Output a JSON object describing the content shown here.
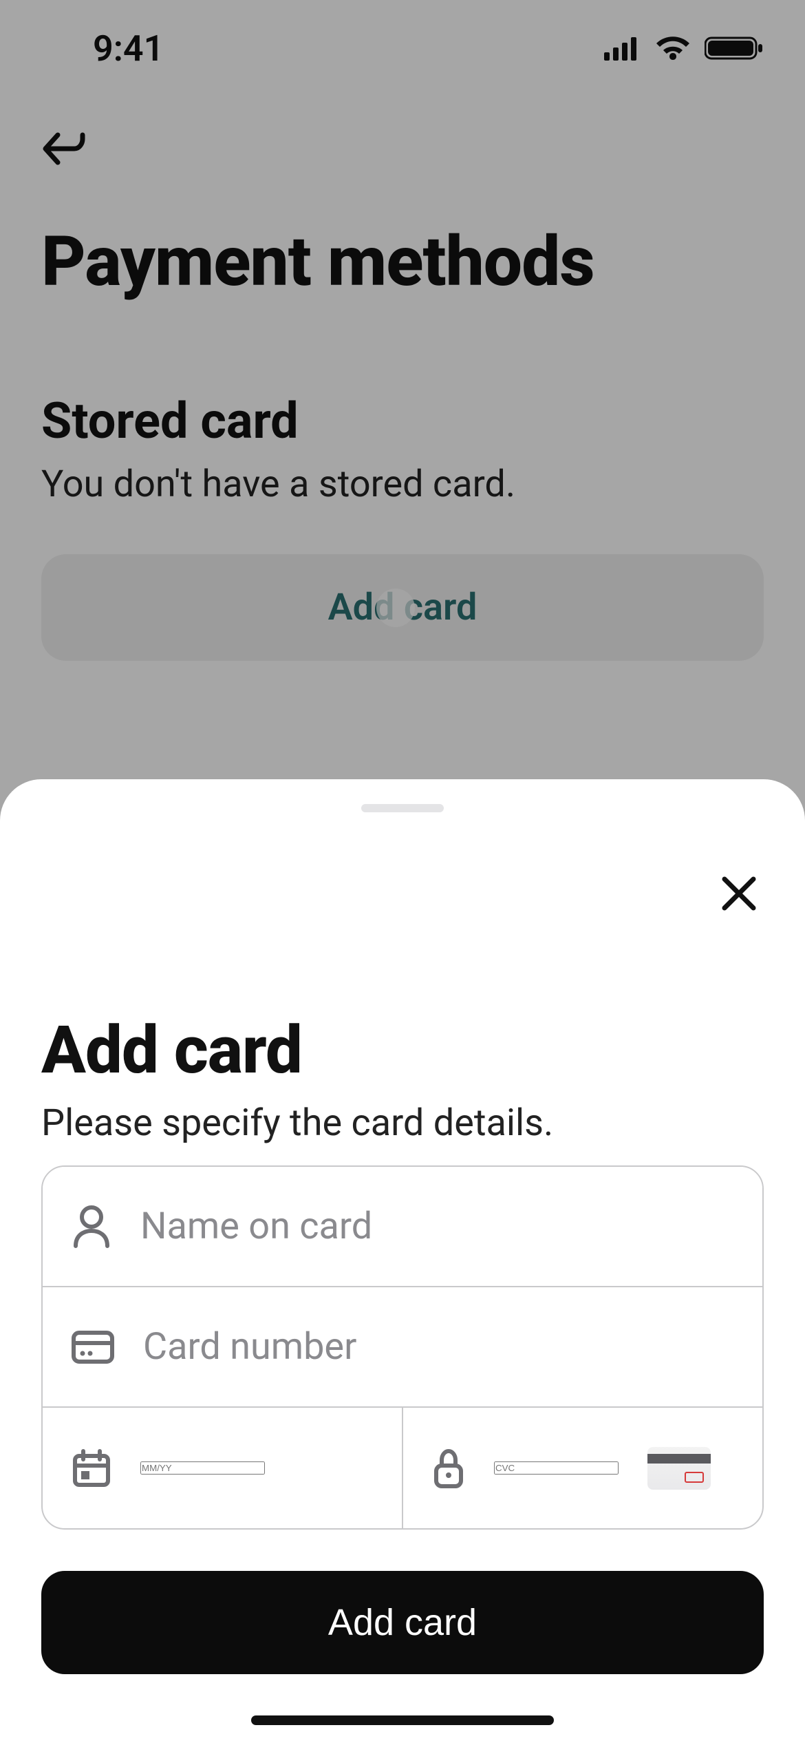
{
  "status": {
    "time": "9:41"
  },
  "page": {
    "title": "Payment methods",
    "section_title": "Stored card",
    "section_sub": "You don't have a stored card.",
    "add_card_label": "Add card"
  },
  "sheet": {
    "title": "Add card",
    "subtitle": "Please specify the card details.",
    "name_placeholder": "Name on card",
    "number_placeholder": "Card number",
    "expiry_placeholder": "MM/YY",
    "cvc_placeholder": "CVC",
    "submit_label": "Add card",
    "name_value": "",
    "number_value": "",
    "expiry_value": "",
    "cvc_value": ""
  }
}
